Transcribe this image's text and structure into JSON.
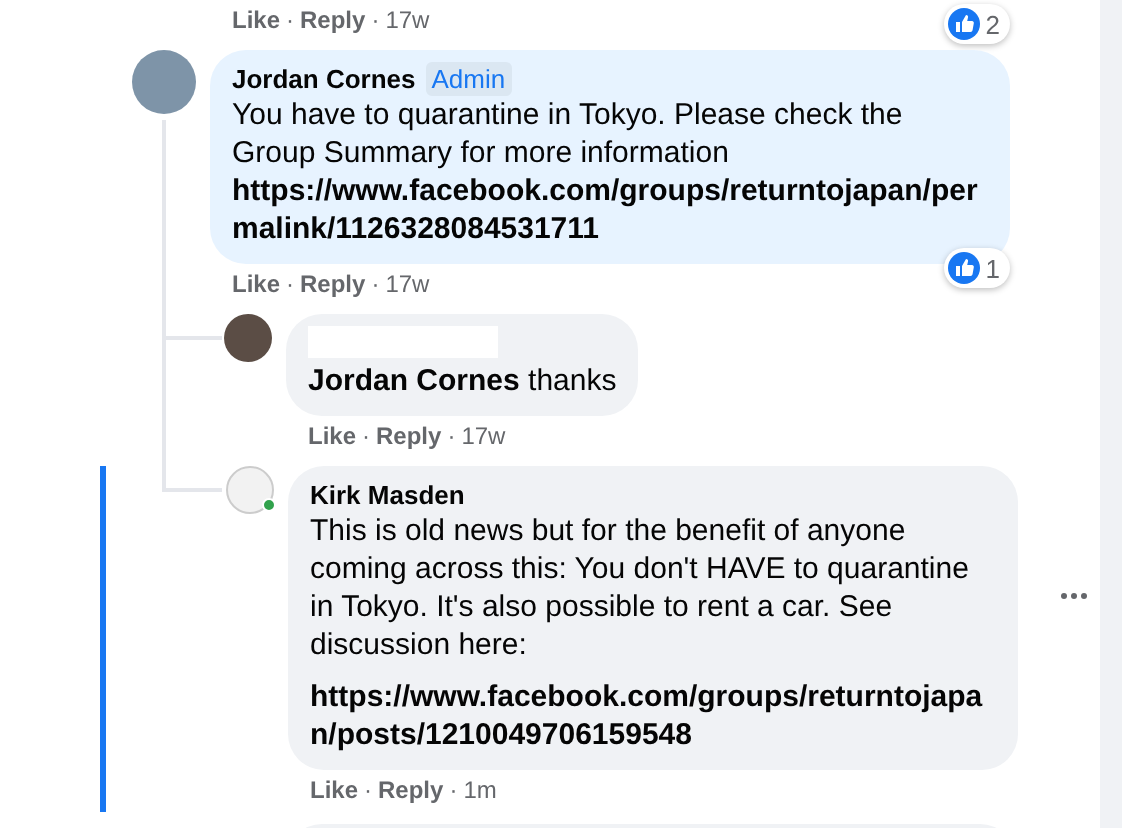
{
  "separator": "·",
  "previous_comment": {
    "actions": [
      "Like",
      "Reply"
    ],
    "time": "17w",
    "reaction_count": "2"
  },
  "comments": [
    {
      "author": "Jordan Cornes",
      "badge": "Admin",
      "name_redacted": false,
      "highlighted": false,
      "online": false,
      "text": "You have to quarantine in Tokyo. Please check the Group Summary for more information",
      "link": "https://www.facebook.com/groups/returntojapan/permalink/1126328084531711",
      "actions": [
        "Like",
        "Reply"
      ],
      "time": "17w",
      "reaction_count": "1",
      "reply": false
    },
    {
      "name_redacted": true,
      "highlighted": false,
      "online": false,
      "text": "**Jordan Cornes** thanks",
      "actions": [
        "Like",
        "Reply"
      ],
      "time": "17w",
      "reply": true
    },
    {
      "author": "Kirk Masden",
      "name_redacted": false,
      "highlighted": true,
      "online": true,
      "text": "This is old news but for the benefit of anyone coming across this: You don't HAVE to quarantine in Tokyo. It's also possible to rent a car. See discussion here:",
      "link": "https://www.facebook.com/groups/returntojapan/posts/1210049706159548",
      "actions": [
        "Like",
        "Reply"
      ],
      "time": "1m",
      "reply": true
    }
  ]
}
